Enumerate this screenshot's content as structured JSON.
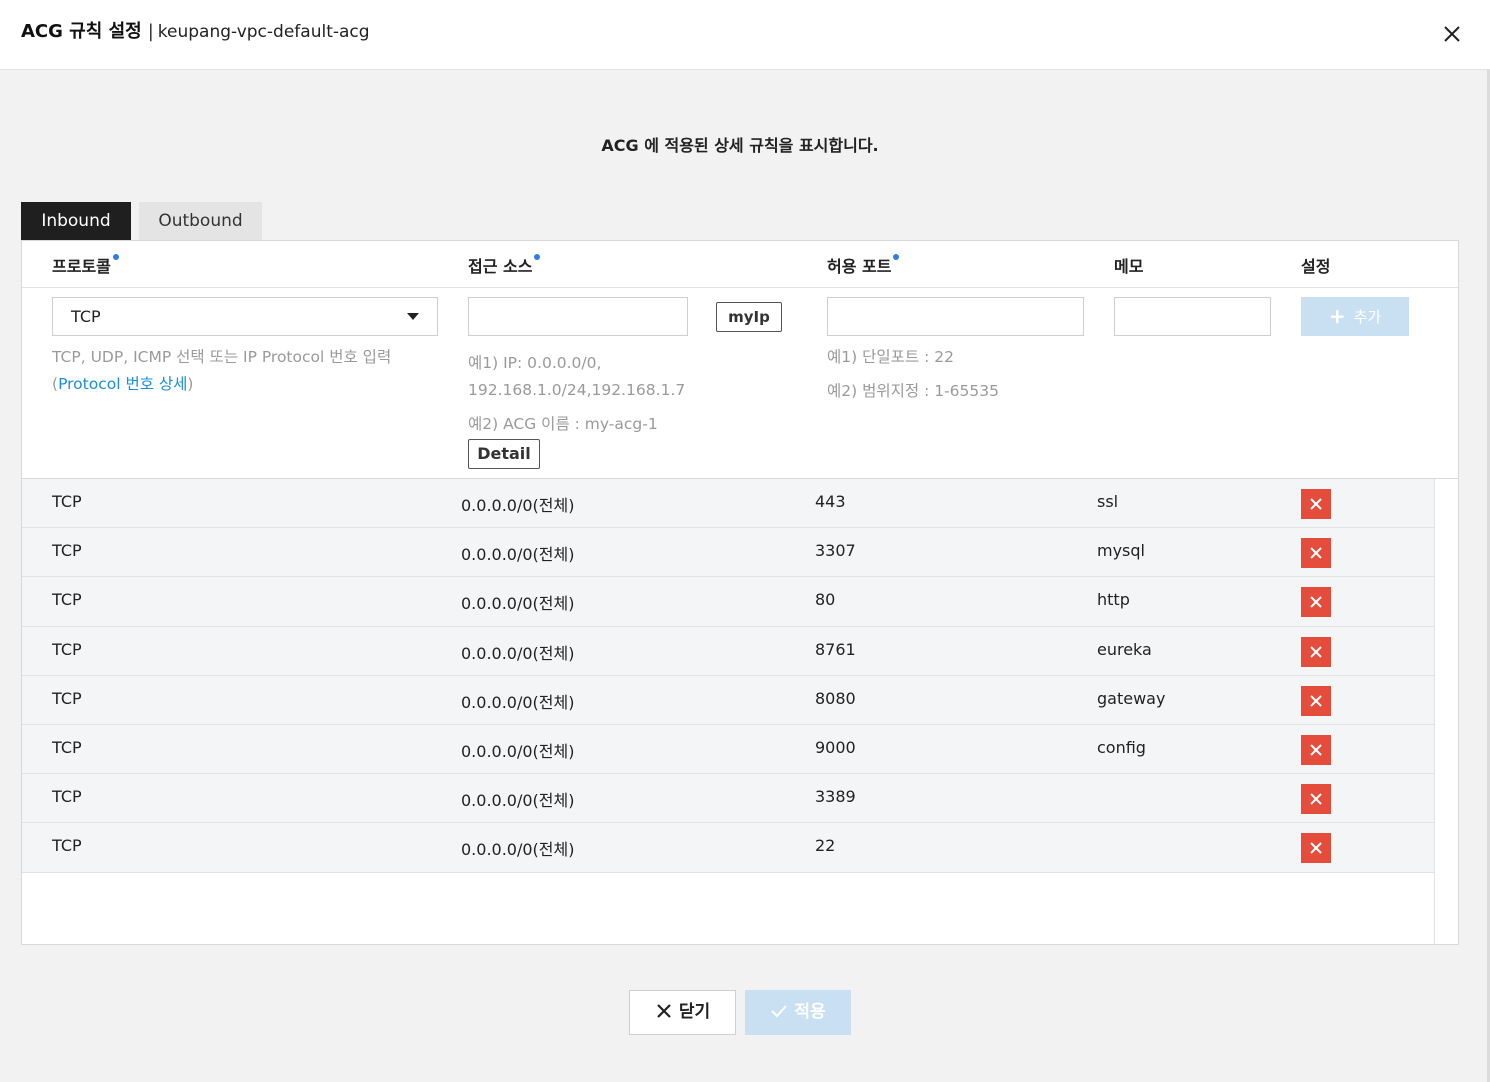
{
  "dialog": {
    "title": "ACG 규칙 설정",
    "separator": "|",
    "subtitle": "keupang-vpc-default-acg",
    "close_icon": "close-icon"
  },
  "description": "ACG 에 적용된 상세 규칙을 표시합니다.",
  "tabs": [
    {
      "label": "Inbound",
      "active": true
    },
    {
      "label": "Outbound",
      "active": false
    }
  ],
  "columns": {
    "protocol": "프로토콜",
    "source": "접근 소스",
    "port": "허용 포트",
    "memo": "메모",
    "settings": "설정"
  },
  "form": {
    "protocol_value": "TCP",
    "protocol_hint_1": "TCP, UDP, ICMP 선택 또는 IP Protocol 번호 입력",
    "protocol_hint_open": "(",
    "protocol_hint_link": "Protocol 번호 상세",
    "protocol_hint_close": ")",
    "source_value": "",
    "myip_label": "myIp",
    "source_hint_1": "예1) IP: 0.0.0.0/0,",
    "source_hint_2": "192.168.1.0/24,192.168.1.7",
    "source_hint_3": "예2) ACG 이름 : my-acg-1",
    "detail_label": "Detail",
    "port_value": "",
    "port_hint_1": "예1) 단일포트 : 22",
    "port_hint_2": "예2) 범위지정 : 1-65535",
    "memo_value": "",
    "add_label": "추가",
    "accent": "#c8e0f2"
  },
  "rules": [
    {
      "protocol": "TCP",
      "source": "0.0.0.0/0(전체)",
      "port": "443",
      "memo": "ssl"
    },
    {
      "protocol": "TCP",
      "source": "0.0.0.0/0(전체)",
      "port": "3307",
      "memo": "mysql"
    },
    {
      "protocol": "TCP",
      "source": "0.0.0.0/0(전체)",
      "port": "80",
      "memo": "http"
    },
    {
      "protocol": "TCP",
      "source": "0.0.0.0/0(전체)",
      "port": "8761",
      "memo": "eureka"
    },
    {
      "protocol": "TCP",
      "source": "0.0.0.0/0(전체)",
      "port": "8080",
      "memo": "gateway"
    },
    {
      "protocol": "TCP",
      "source": "0.0.0.0/0(전체)",
      "port": "9000",
      "memo": "config"
    },
    {
      "protocol": "TCP",
      "source": "0.0.0.0/0(전체)",
      "port": "3389",
      "memo": ""
    },
    {
      "protocol": "TCP",
      "source": "0.0.0.0/0(전체)",
      "port": "22",
      "memo": ""
    }
  ],
  "delete_color": "#e44c3c",
  "footer": {
    "close_label": "닫기",
    "apply_label": "적용"
  }
}
